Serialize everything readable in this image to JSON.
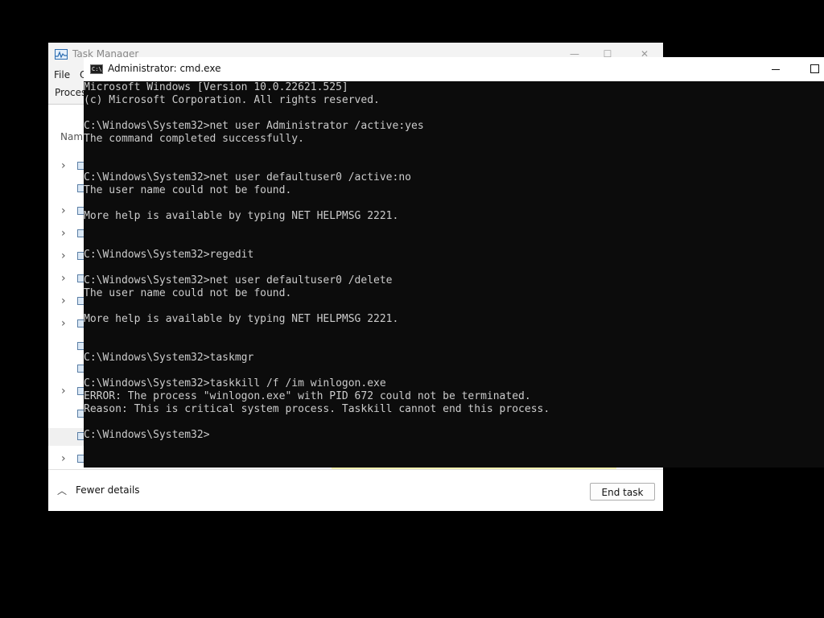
{
  "task_manager": {
    "title": "Task Manager",
    "minimize": "—",
    "maximize": "☐",
    "close": "✕",
    "menu": [
      "File",
      "O"
    ],
    "tab_label": "Proces",
    "column_header": "Nam",
    "fewer_details": "Fewer details",
    "end_task": "End task"
  },
  "cmd": {
    "title": "Administrator: cmd.exe",
    "icon_text": "C:\\",
    "lines": [
      "Microsoft Windows [Version 10.0.22621.525]",
      "(c) Microsoft Corporation. All rights reserved.",
      "C:\\Windows\\System32>net user Administrator /active:yes",
      "The command completed successfully.",
      "C:\\Windows\\System32>net user defaultuser0 /active:no",
      "The user name could not be found.",
      "More help is available by typing NET HELPMSG 2221.",
      "C:\\Windows\\System32>regedit",
      "C:\\Windows\\System32>net user defaultuser0 /delete",
      "The user name could not be found.",
      "More help is available by typing NET HELPMSG 2221.",
      "C:\\Windows\\System32>taskmgr",
      "C:\\Windows\\System32>taskkill /f /im winlogon.exe",
      "ERROR: The process \"winlogon.exe\" with PID 672 could not be terminated.",
      "Reason: This is critical system process. Taskkill cannot end this process.",
      "C:\\Windows\\System32>"
    ]
  },
  "colors": {
    "console_bg": "#0c0c0c",
    "console_fg": "#cccccc",
    "desktop_bg": "#000000"
  }
}
